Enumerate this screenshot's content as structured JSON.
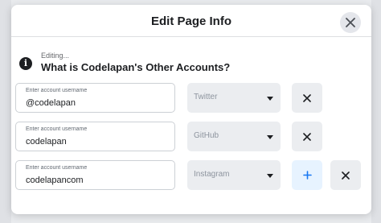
{
  "modal": {
    "title": "Edit Page Info",
    "editing_label": "Editing...",
    "question": "What is Codelapan's Other Accounts?",
    "info_icon_glyph": "i"
  },
  "accounts": [
    {
      "field_label": "Enter account username",
      "username": "@codelapan",
      "platform": "Twitter"
    },
    {
      "field_label": "Enter account username",
      "username": "codelapan",
      "platform": "GitHub"
    },
    {
      "field_label": "Enter account username",
      "username": "codelapancom",
      "platform": "Instagram"
    }
  ],
  "icons": {
    "close": "close-icon",
    "remove": "x-icon",
    "add": "plus-icon",
    "info": "info-icon",
    "caret": "caret-down-icon"
  },
  "colors": {
    "accent": "#1877f2",
    "add_button_bg": "#e7f3ff",
    "control_bg": "#ebedf0"
  }
}
